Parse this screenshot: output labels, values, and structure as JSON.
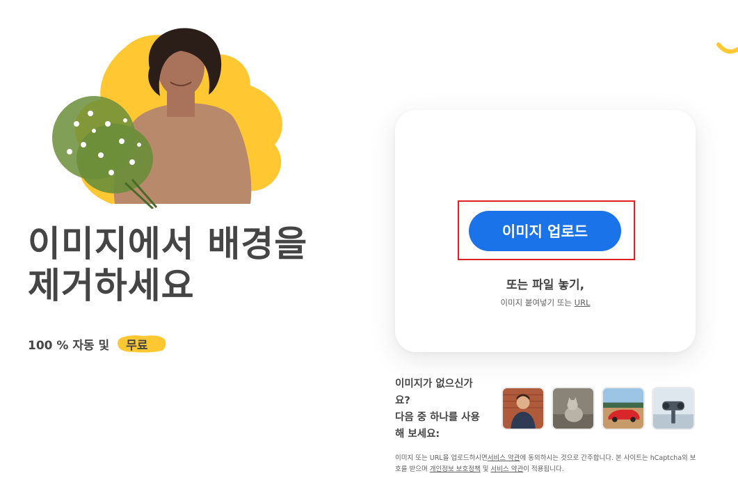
{
  "hero": {
    "headline_line1": "이미지에서 배경을",
    "headline_line2": "제거하세요",
    "tagline": "100 % 자동 및",
    "free_badge": "무료"
  },
  "upload": {
    "button_label": "이미지 업로드",
    "drop_text": "또는 파일 놓기,",
    "paste_prefix": "이미지 붙여넣기 또는",
    "url_link": "URL"
  },
  "samples": {
    "prompt_line1": "이미지가 없으신가",
    "prompt_line2": "요?",
    "prompt_line3": "다음 중 하나를 사용",
    "prompt_line4": "해 보세요:",
    "items": [
      "person-sample",
      "cat-sample",
      "car-sample",
      "binoculars-sample"
    ]
  },
  "legal": {
    "part1": "이미지 또는 URL을 업로드하시면",
    "terms_link": "서비스 약관",
    "part2": "에 동의하시는 것으로 간주합니다. 본 사이트는 hCaptcha의 보호를 받으며",
    "privacy_link": "개인정보 보호정책",
    "part3": "및",
    "terms_link2": "서비스 약관",
    "part4": "이 적용됩니다."
  },
  "colors": {
    "accent_blue": "#1a73e8",
    "brand_yellow": "#ffc732",
    "highlight_red": "#e02020",
    "text_dark": "#454545"
  }
}
